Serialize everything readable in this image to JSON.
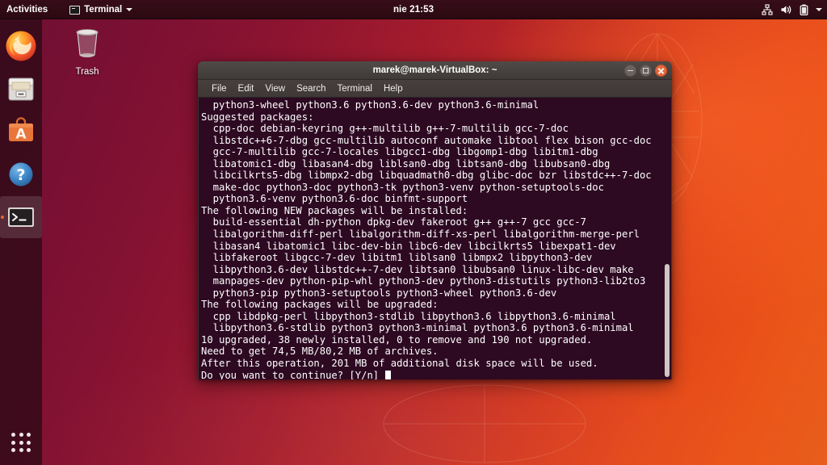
{
  "top_panel": {
    "activities_label": "Activities",
    "app_menu_label": "Terminal",
    "app_menu_icon": "terminal-icon",
    "clock": "nie 21:53",
    "tray_icons": [
      "network-icon",
      "volume-icon",
      "battery-icon",
      "chevron-down-icon"
    ]
  },
  "dock": {
    "items": [
      {
        "name": "firefox",
        "label": "Firefox Web Browser",
        "icon": "firefox-icon",
        "active": false
      },
      {
        "name": "files",
        "label": "Files",
        "icon": "file-manager-icon",
        "active": false
      },
      {
        "name": "software",
        "label": "Ubuntu Software",
        "icon": "ubuntu-software-icon",
        "active": false
      },
      {
        "name": "help",
        "label": "Help",
        "icon": "help-question-icon",
        "active": false
      },
      {
        "name": "terminal",
        "label": "Terminal",
        "icon": "terminal-icon",
        "active": true
      }
    ],
    "show_apps_label": "Show Applications",
    "show_apps_icon": "app-grid-icon"
  },
  "desktop": {
    "trash_label": "Trash",
    "trash_icon": "trash-icon"
  },
  "window": {
    "title": "marek@marek-VirtualBox: ~",
    "controls": {
      "minimize": "minimize-button",
      "maximize": "maximize-button",
      "close": "close-button"
    },
    "menu": [
      "File",
      "Edit",
      "View",
      "Search",
      "Terminal",
      "Help"
    ]
  },
  "terminal": {
    "lines": [
      "  python3-wheel python3.6 python3.6-dev python3.6-minimal",
      "Suggested packages:",
      "  cpp-doc debian-keyring g++-multilib g++-7-multilib gcc-7-doc",
      "  libstdc++6-7-dbg gcc-multilib autoconf automake libtool flex bison gcc-doc",
      "  gcc-7-multilib gcc-7-locales libgcc1-dbg libgomp1-dbg libitm1-dbg",
      "  libatomic1-dbg libasan4-dbg liblsan0-dbg libtsan0-dbg libubsan0-dbg",
      "  libcilkrts5-dbg libmpx2-dbg libquadmath0-dbg glibc-doc bzr libstdc++-7-doc",
      "  make-doc python3-doc python3-tk python3-venv python-setuptools-doc",
      "  python3.6-venv python3.6-doc binfmt-support",
      "The following NEW packages will be installed:",
      "  build-essential dh-python dpkg-dev fakeroot g++ g++-7 gcc gcc-7",
      "  libalgorithm-diff-perl libalgorithm-diff-xs-perl libalgorithm-merge-perl",
      "  libasan4 libatomic1 libc-dev-bin libc6-dev libcilkrts5 libexpat1-dev",
      "  libfakeroot libgcc-7-dev libitm1 liblsan0 libmpx2 libpython3-dev",
      "  libpython3.6-dev libstdc++-7-dev libtsan0 libubsan0 linux-libc-dev make",
      "  manpages-dev python-pip-whl python3-dev python3-distutils python3-lib2to3",
      "  python3-pip python3-setuptools python3-wheel python3.6-dev",
      "The following packages will be upgraded:",
      "  cpp libdpkg-perl libpython3-stdlib libpython3.6 libpython3.6-minimal",
      "  libpython3.6-stdlib python3 python3-minimal python3.6 python3.6-minimal",
      "10 upgraded, 38 newly installed, 0 to remove and 190 not upgraded.",
      "Need to get 74,5 MB/80,2 MB of archives.",
      "After this operation, 201 MB of additional disk space will be used."
    ],
    "prompt_line": "Do you want to continue? [Y/n] ",
    "background_color": "#2d0922",
    "foreground_color": "#ffffff"
  }
}
